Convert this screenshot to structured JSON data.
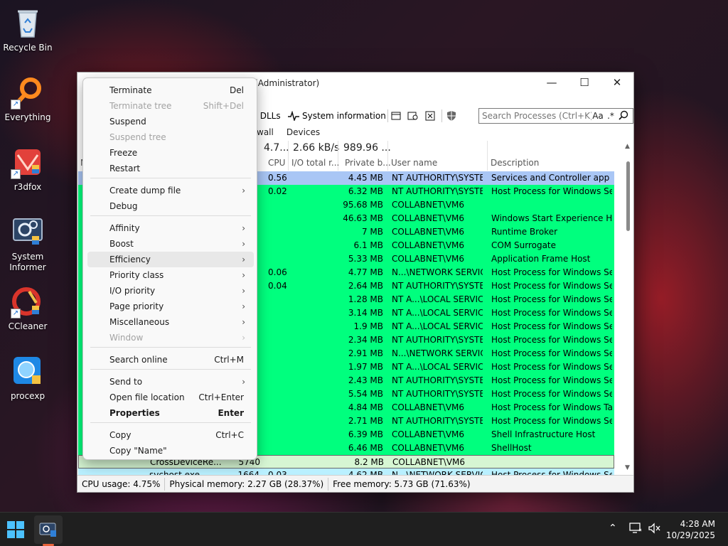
{
  "desktop": {
    "icons": [
      {
        "label": "Recycle Bin",
        "icon": "recycle-bin-icon"
      },
      {
        "label": "Everything",
        "icon": "everything-search-icon"
      },
      {
        "label": "r3dfox",
        "icon": "r3dfox-browser-icon"
      },
      {
        "label": "System Informer",
        "icon": "system-informer-icon"
      },
      {
        "label": "CCleaner",
        "icon": "ccleaner-icon"
      },
      {
        "label": "procexp",
        "icon": "process-explorer-icon"
      }
    ]
  },
  "window": {
    "title": "System Informer [COLLABNET\\VM6] (Administrator)",
    "minimize": "—",
    "maximize": "☐",
    "close": "✕",
    "toolbar": {
      "dlls_label": "r DLLs",
      "sysinfo_label": "System information",
      "search_placeholder": "Search Processes (Ctrl+K)",
      "case_btn": "Aa",
      "regex_btn": ".*",
      "search_btn": "⌕"
    },
    "tabs": [
      "wall",
      "Devices"
    ],
    "summaries": {
      "cpu": "4.7...",
      "io": "2.66 kB/s",
      "private": "989.96 ..."
    },
    "headers": {
      "name": "N",
      "cpu": "CPU",
      "io": "I/O total r...",
      "private": "Private b...",
      "user": "User name",
      "description": "Description"
    }
  },
  "processes": [
    {
      "name": "",
      "pid": "",
      "cpu": "0.56",
      "private": "4.45 MB",
      "user": "NT AUTHORITY\\SYSTEM",
      "description": "Services and Controller app",
      "color": "blue"
    },
    {
      "name": "",
      "pid": "",
      "cpu": "0.02",
      "private": "6.32 MB",
      "user": "NT AUTHORITY\\SYSTEM",
      "description": "Host Process for Windows Ser...",
      "color": "green"
    },
    {
      "name": "",
      "pid": "",
      "cpu": "",
      "private": "95.68 MB",
      "user": "COLLABNET\\VM6",
      "description": "",
      "color": "green"
    },
    {
      "name": "",
      "pid": "",
      "cpu": "",
      "private": "46.63 MB",
      "user": "COLLABNET\\VM6",
      "description": "Windows Start Experience Host",
      "color": "green"
    },
    {
      "name": "",
      "pid": "",
      "cpu": "",
      "private": "7 MB",
      "user": "COLLABNET\\VM6",
      "description": "Runtime Broker",
      "color": "green"
    },
    {
      "name": "",
      "pid": "",
      "cpu": "",
      "private": "6.1 MB",
      "user": "COLLABNET\\VM6",
      "description": "COM Surrogate",
      "color": "green"
    },
    {
      "name": "",
      "pid": "",
      "cpu": "",
      "private": "5.33 MB",
      "user": "COLLABNET\\VM6",
      "description": "Application Frame Host",
      "color": "green"
    },
    {
      "name": "",
      "pid": "",
      "cpu": "0.06",
      "private": "4.77 MB",
      "user": "N...\\NETWORK SERVICE",
      "description": "Host Process for Windows Ser...",
      "color": "green"
    },
    {
      "name": "",
      "pid": "",
      "cpu": "0.04",
      "private": "2.64 MB",
      "user": "NT AUTHORITY\\SYSTEM",
      "description": "Host Process for Windows Ser...",
      "color": "green"
    },
    {
      "name": "",
      "pid": "",
      "cpu": "",
      "private": "1.28 MB",
      "user": "NT A...\\LOCAL SERVICE",
      "description": "Host Process for Windows Ser...",
      "color": "green"
    },
    {
      "name": "",
      "pid": "",
      "cpu": "",
      "private": "3.14 MB",
      "user": "NT A...\\LOCAL SERVICE",
      "description": "Host Process for Windows Ser...",
      "color": "green"
    },
    {
      "name": "",
      "pid": "",
      "cpu": "",
      "private": "1.9 MB",
      "user": "NT A...\\LOCAL SERVICE",
      "description": "Host Process for Windows Ser...",
      "color": "green"
    },
    {
      "name": "",
      "pid": "",
      "cpu": "",
      "private": "2.34 MB",
      "user": "NT AUTHORITY\\SYSTEM",
      "description": "Host Process for Windows Ser...",
      "color": "green"
    },
    {
      "name": "",
      "pid": "",
      "cpu": "",
      "private": "2.91 MB",
      "user": "N...\\NETWORK SERVICE",
      "description": "Host Process for Windows Ser...",
      "color": "green"
    },
    {
      "name": "",
      "pid": "",
      "cpu": "",
      "private": "1.97 MB",
      "user": "NT A...\\LOCAL SERVICE",
      "description": "Host Process for Windows Ser...",
      "color": "green"
    },
    {
      "name": "",
      "pid": "",
      "cpu": "",
      "private": "2.43 MB",
      "user": "NT AUTHORITY\\SYSTEM",
      "description": "Host Process for Windows Ser...",
      "color": "green"
    },
    {
      "name": "",
      "pid": "",
      "cpu": "",
      "private": "5.54 MB",
      "user": "NT AUTHORITY\\SYSTEM",
      "description": "Host Process for Windows Ser...",
      "color": "green"
    },
    {
      "name": "",
      "pid": "",
      "cpu": "",
      "private": "4.84 MB",
      "user": "COLLABNET\\VM6",
      "description": "Host Process for Windows Tas...",
      "color": "green"
    },
    {
      "name": "",
      "pid": "",
      "cpu": "",
      "private": "2.71 MB",
      "user": "NT AUTHORITY\\SYSTEM",
      "description": "Host Process for Windows Ser...",
      "color": "green"
    },
    {
      "name": "",
      "pid": "",
      "cpu": "",
      "private": "6.39 MB",
      "user": "COLLABNET\\VM6",
      "description": "Shell Infrastructure Host",
      "color": "green"
    },
    {
      "name": "",
      "pid": "",
      "cpu": "",
      "private": "6.46 MB",
      "user": "COLLABNET\\VM6",
      "description": "ShellHost",
      "color": "green"
    },
    {
      "name": "CrossDeviceRe...",
      "pid": "5740",
      "cpu": "",
      "private": "8.2 MB",
      "user": "COLLABNET\\VM6",
      "description": "",
      "color": "pale"
    },
    {
      "name": "svchost.exe",
      "pid": "1664",
      "cpu": "0.03",
      "private": "4.62 MB",
      "user": "N...\\NETWORK SERVICE",
      "description": "Host Process for Windows Ser...",
      "color": "cyan"
    }
  ],
  "status": {
    "cpu": "CPU usage: 4.75%",
    "physical": "Physical memory: 2.27 GB (28.37%)",
    "free": "Free memory: 5.73 GB (71.63%)"
  },
  "context_menu": {
    "items": [
      {
        "label": "Terminate",
        "shortcut": "Del"
      },
      {
        "label": "Terminate tree",
        "shortcut": "Shift+Del"
      },
      {
        "label": "Suspend",
        "shortcut": ""
      },
      {
        "label": "Suspend tree",
        "shortcut": ""
      },
      {
        "label": "Freeze",
        "shortcut": ""
      },
      {
        "label": "Restart",
        "shortcut": ""
      },
      {
        "label": "Create dump file",
        "shortcut": ""
      },
      {
        "label": "Debug",
        "shortcut": ""
      },
      {
        "label": "Affinity",
        "shortcut": ""
      },
      {
        "label": "Boost",
        "shortcut": ""
      },
      {
        "label": "Efficiency",
        "shortcut": ""
      },
      {
        "label": "Priority class",
        "shortcut": ""
      },
      {
        "label": "I/O priority",
        "shortcut": ""
      },
      {
        "label": "Page priority",
        "shortcut": ""
      },
      {
        "label": "Miscellaneous",
        "shortcut": ""
      },
      {
        "label": "Window",
        "shortcut": ""
      },
      {
        "label": "Search online",
        "shortcut": "Ctrl+M"
      },
      {
        "label": "Send to",
        "shortcut": ""
      },
      {
        "label": "Open file location",
        "shortcut": "Ctrl+Enter"
      },
      {
        "label": "Properties",
        "shortcut": "Enter"
      },
      {
        "label": "Copy",
        "shortcut": "Ctrl+C"
      },
      {
        "label": "Copy \"Name\"",
        "shortcut": ""
      }
    ]
  },
  "taskbar": {
    "time": "4:28 AM",
    "date": "10/29/2025",
    "tray_chevron": "⌃"
  },
  "colors": {
    "row_green": "#00ff7e",
    "row_blue": "#a9c6f5",
    "row_pale": "#d6f6d3",
    "row_cyan": "#b9f0ff",
    "accent_orange": "#e8633b"
  }
}
